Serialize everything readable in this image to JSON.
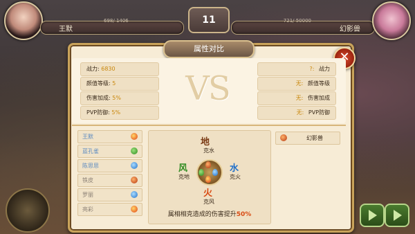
{
  "hud": {
    "round": "11",
    "left": {
      "name": "王默",
      "hp": "698/ 1406"
    },
    "right": {
      "name": "幻影兽",
      "hp": "721/ 50000"
    }
  },
  "panel": {
    "title": "属性对比",
    "close_label": "✕",
    "vs": "VS",
    "left_stats": [
      {
        "label": "战力:",
        "value": "6830"
      },
      {
        "label": "颜值等级:",
        "value": "5"
      },
      {
        "label": "伤害加成:",
        "value": "5%"
      },
      {
        "label": "PVP防御:",
        "value": "5%"
      }
    ],
    "right_stats": [
      {
        "value": "?:",
        "label": "战力"
      },
      {
        "value": "无:",
        "label": "颜值等级"
      },
      {
        "value": "无:",
        "label": "伤害加成"
      },
      {
        "value": "无:",
        "label": "PVP防御"
      }
    ],
    "team": [
      {
        "name": "王默",
        "element": "fire"
      },
      {
        "name": "蓝孔雀",
        "element": "wind"
      },
      {
        "name": "陈思思",
        "element": "water"
      },
      {
        "name": "铁皮",
        "element": "earth"
      },
      {
        "name": "罗丽",
        "element": "water"
      },
      {
        "name": "亮彩",
        "element": "fire"
      }
    ],
    "enemy": {
      "name": "幻影兽",
      "element": "earth"
    },
    "wheel": {
      "top": {
        "name": "地",
        "sub": "克水"
      },
      "left": {
        "name": "风",
        "sub": "克地"
      },
      "right": {
        "name": "水",
        "sub": "克火"
      },
      "bottom": {
        "name": "火",
        "sub": "克风"
      },
      "caption_prefix": "属相相克造成的伤害提升",
      "caption_pct": "50%"
    }
  },
  "colors": {
    "earth": "#b5340e",
    "wind": "#2c8a1e",
    "water": "#1f6fc9",
    "fire": "#e23d12"
  }
}
